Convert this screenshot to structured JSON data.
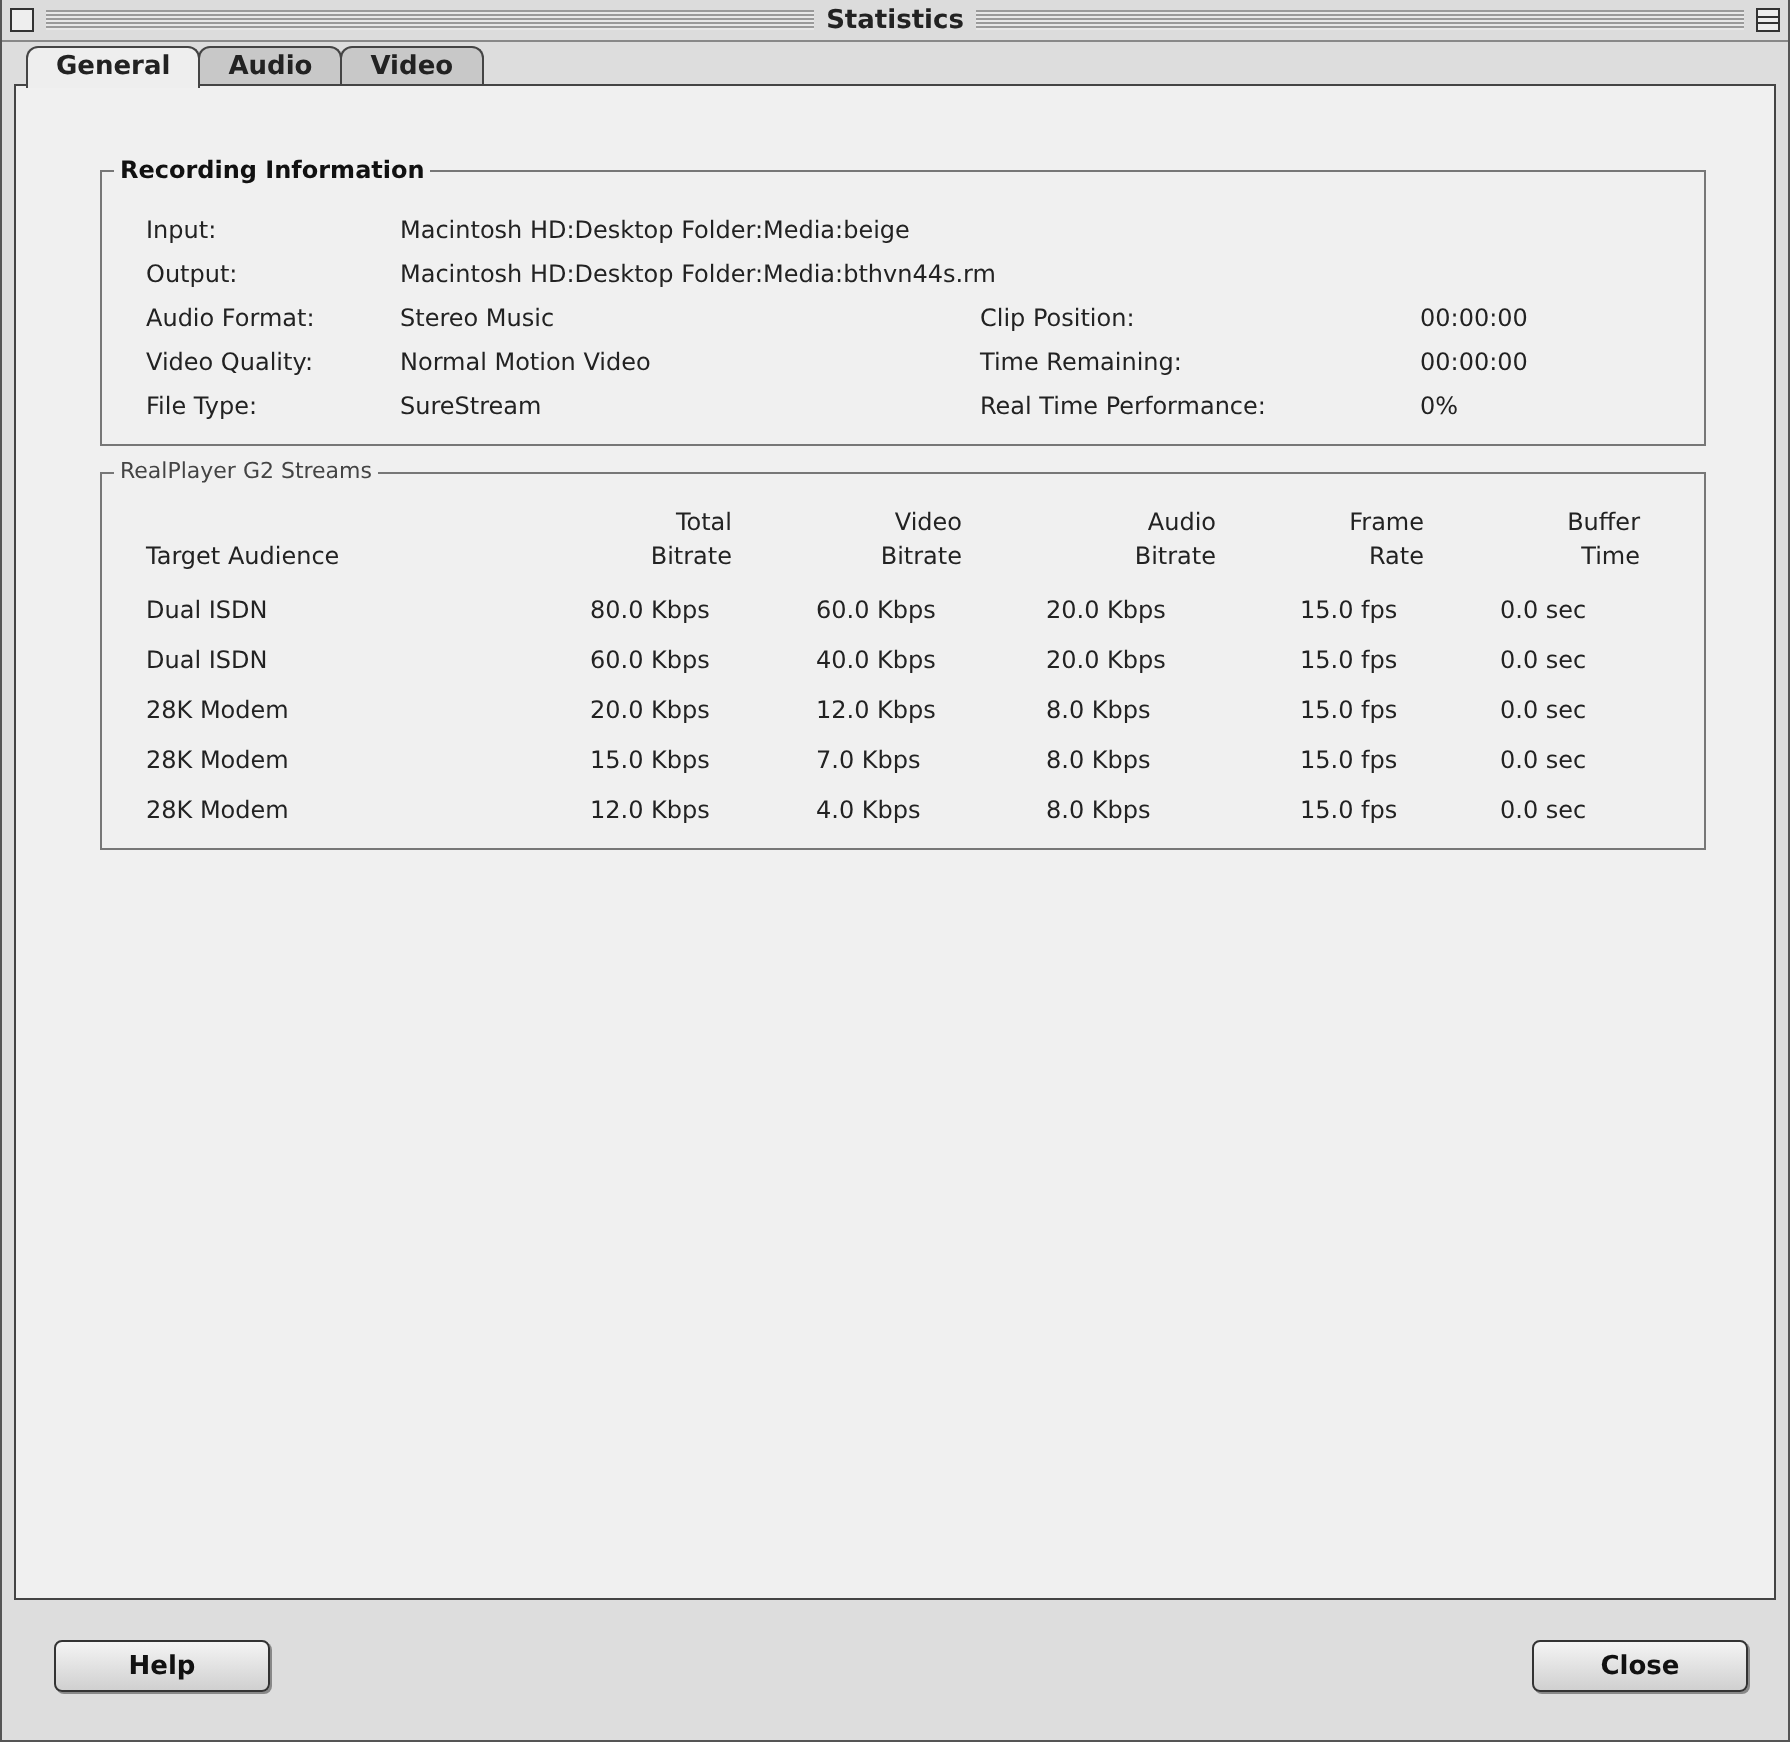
{
  "window": {
    "title": "Statistics"
  },
  "tabs": [
    {
      "label": "General",
      "selected": true
    },
    {
      "label": "Audio",
      "selected": false
    },
    {
      "label": "Video",
      "selected": false
    }
  ],
  "recording_information": {
    "title": "Recording Information",
    "fields": [
      {
        "label": "Input:",
        "value": "Macintosh HD:Desktop Folder:Media:beige"
      },
      {
        "label": "Output:",
        "value": "Macintosh HD:Desktop Folder:Media:bthvn44s.rm"
      },
      {
        "label": "Audio Format:",
        "value": "Stereo Music"
      },
      {
        "label": "Video Quality:",
        "value": "Normal Motion Video"
      },
      {
        "label": "File Type:",
        "value": "SureStream"
      }
    ],
    "right_fields": [
      {
        "label": "Clip Position:",
        "value": "00:00:00"
      },
      {
        "label": "Time Remaining:",
        "value": "00:00:00"
      },
      {
        "label": "Real Time Performance:",
        "value": "0%"
      }
    ]
  },
  "streams": {
    "title": "RealPlayer G2 Streams",
    "columns": [
      "Target Audience",
      "Total\nBitrate",
      "Video\nBitrate",
      "Audio\nBitrate",
      "Frame\nRate",
      "Buffer\nTime"
    ],
    "rows": [
      [
        "Dual ISDN",
        "80.0 Kbps",
        "60.0 Kbps",
        "20.0 Kbps",
        "15.0 fps",
        "0.0 sec"
      ],
      [
        "Dual ISDN",
        "60.0 Kbps",
        "40.0 Kbps",
        "20.0 Kbps",
        "15.0 fps",
        "0.0 sec"
      ],
      [
        "28K Modem",
        "20.0 Kbps",
        "12.0 Kbps",
        "8.0 Kbps",
        "15.0 fps",
        "0.0 sec"
      ],
      [
        "28K Modem",
        "15.0 Kbps",
        "7.0 Kbps",
        "8.0 Kbps",
        "15.0 fps",
        "0.0 sec"
      ],
      [
        "28K Modem",
        "12.0 Kbps",
        "4.0 Kbps",
        "8.0 Kbps",
        "15.0 fps",
        "0.0 sec"
      ]
    ]
  },
  "buttons": [
    "Help",
    "Close"
  ]
}
